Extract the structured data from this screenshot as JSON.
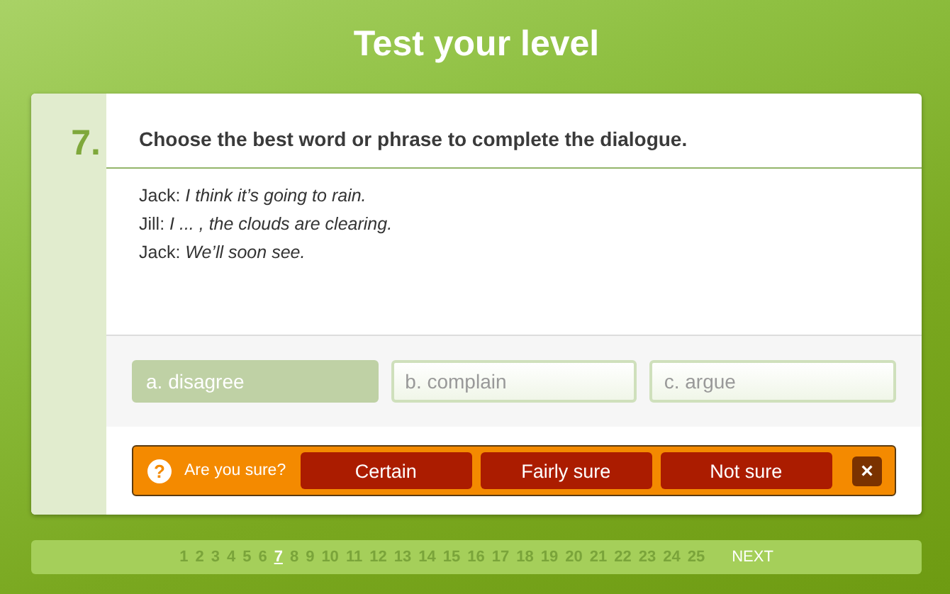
{
  "title": "Test your level",
  "question": {
    "number": "7.",
    "instruction": "Choose the best word or phrase to complete the dialogue.",
    "lines": [
      {
        "speaker": "Jack:",
        "text": "I think it’s going to rain."
      },
      {
        "speaker": "Jill:",
        "text": "I ... , the clouds are clearing."
      },
      {
        "speaker": "Jack:",
        "text": "We’ll soon see."
      }
    ],
    "options": [
      {
        "label": "a. disagree",
        "selected": true
      },
      {
        "label": "b. complain",
        "selected": false
      },
      {
        "label": "c. argue",
        "selected": false
      }
    ]
  },
  "confidence": {
    "help": "?",
    "prompt": "Are you sure?",
    "buttons": [
      "Certain",
      "Fairly sure",
      "Not sure"
    ],
    "close": "×"
  },
  "pages": [
    {
      "label": "1",
      "selected": false
    },
    {
      "label": "2",
      "selected": false
    },
    {
      "label": "3",
      "selected": false
    },
    {
      "label": "4",
      "selected": false
    },
    {
      "label": "5",
      "selected": false
    },
    {
      "label": "6",
      "selected": false
    },
    {
      "label": "7",
      "selected": true
    },
    {
      "label": "8",
      "selected": false
    },
    {
      "label": "9",
      "selected": false
    },
    {
      "label": "10",
      "selected": false
    },
    {
      "label": "11",
      "selected": false
    },
    {
      "label": "12",
      "selected": false
    },
    {
      "label": "13",
      "selected": false
    },
    {
      "label": "14",
      "selected": false
    },
    {
      "label": "15",
      "selected": false
    },
    {
      "label": "16",
      "selected": false
    },
    {
      "label": "17",
      "selected": false
    },
    {
      "label": "18",
      "selected": false
    },
    {
      "label": "19",
      "selected": false
    },
    {
      "label": "20",
      "selected": false
    },
    {
      "label": "21",
      "selected": false
    },
    {
      "label": "22",
      "selected": false
    },
    {
      "label": "23",
      "selected": false
    },
    {
      "label": "24",
      "selected": false
    },
    {
      "label": "25",
      "selected": false
    }
  ],
  "next": "NEXT"
}
